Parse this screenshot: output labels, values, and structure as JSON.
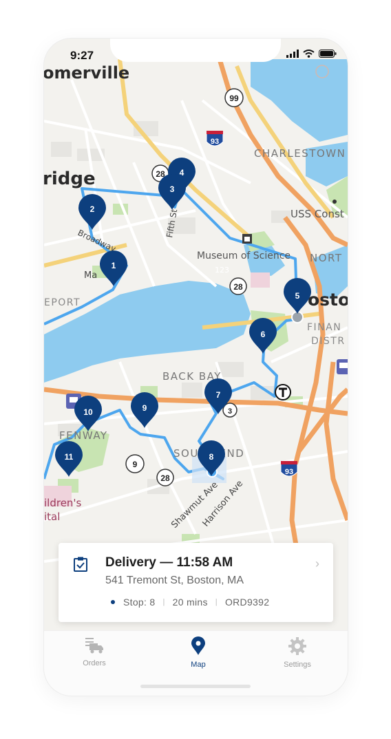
{
  "status_bar": {
    "time": "9:27"
  },
  "map": {
    "place_labels": {
      "somerville": "omerville",
      "cambridge": "ridge",
      "charlestown": "CHARLESTOWN",
      "uss_constitution": "USS Const",
      "north_end": "NORT",
      "museum_of_science": "Museum of Science",
      "boston": "osto",
      "financial_district_1": "FINAN",
      "financial_district_2": "DISTR",
      "back_bay": "BACK BAY",
      "fenway": "FENWAY",
      "south_end": "SOUTH END",
      "childrens_1": "ildren's",
      "childrens_2": "ital",
      "kendall": "EPORT",
      "main_st": "Ma",
      "broadway": "Broadway",
      "fifth_st": "Fifth St",
      "shawmut_ave": "Shawmut Ave",
      "harrison_ave": "Harrison Ave",
      "museum_num": "123"
    },
    "road_shields": {
      "route_99": "99",
      "i93_north": "93",
      "route_28_a": "28",
      "route_28_b": "28",
      "route_28_c": "28",
      "route_9": "9",
      "i93_south": "93",
      "route_3": "3"
    },
    "stops": [
      "1",
      "2",
      "3",
      "4",
      "5",
      "6",
      "7",
      "8",
      "9",
      "10",
      "11"
    ],
    "route_color": "#4da6ee",
    "pin_color": "#0d3f7e"
  },
  "delivery_card": {
    "title": "Delivery — 11:58 AM",
    "address": "541 Tremont St, Boston, MA",
    "stop": "Stop: 8",
    "duration": "20 mins",
    "order_id": "ORD9392"
  },
  "tab_bar": {
    "tabs": [
      {
        "label": "Orders",
        "icon": "truck-list-icon"
      },
      {
        "label": "Map",
        "icon": "map-pin-icon"
      },
      {
        "label": "Settings",
        "icon": "gear-icon"
      }
    ],
    "active": "Map"
  },
  "colors": {
    "accent": "#0d3f7e",
    "route": "#4da6ee",
    "water": "#8ecbef",
    "park": "#c8e4b2"
  }
}
